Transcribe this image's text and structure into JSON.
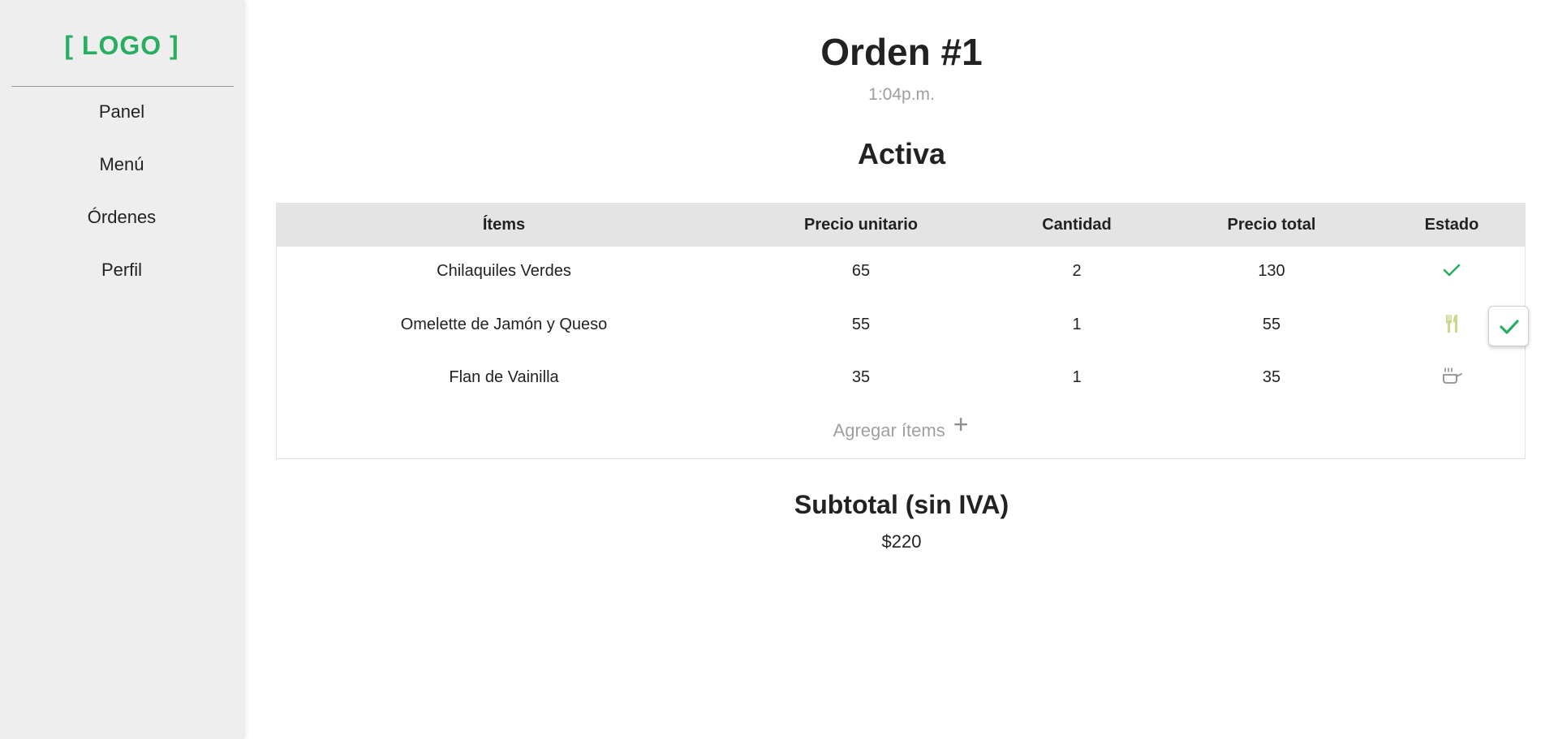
{
  "sidebar": {
    "logo": "[ LOGO ]",
    "items": [
      {
        "label": "Panel"
      },
      {
        "label": "Menú"
      },
      {
        "label": "Órdenes"
      },
      {
        "label": "Perfil"
      }
    ]
  },
  "order": {
    "title": "Orden #1",
    "time": "1:04p.m.",
    "status": "Activa"
  },
  "table": {
    "headers": {
      "items": "Ítems",
      "unit_price": "Precio unitario",
      "quantity": "Cantidad",
      "total_price": "Precio total",
      "state": "Estado"
    },
    "rows": [
      {
        "item": "Chilaquiles Verdes",
        "unit_price": "65",
        "quantity": "2",
        "total_price": "130",
        "state_icon": "check-icon"
      },
      {
        "item": "Omelette de Jamón y Queso",
        "unit_price": "55",
        "quantity": "1",
        "total_price": "55",
        "state_icon": "fork-knife-icon"
      },
      {
        "item": "Flan de Vainilla",
        "unit_price": "35",
        "quantity": "1",
        "total_price": "35",
        "state_icon": "cooking-pot-icon"
      }
    ],
    "add_items_label": "Agregar ítems",
    "add_items_icon": "plus-icon"
  },
  "confirm_button_icon": "check-icon",
  "subtotal": {
    "label": "Subtotal (sin IVA)",
    "value": "$220"
  },
  "colors": {
    "accent_green": "#27ae60",
    "served_icon": "#c9d98a",
    "sidebar_bg": "#eeeeee",
    "header_bg": "#e4e4e4",
    "muted_text": "#9e9e9e"
  }
}
